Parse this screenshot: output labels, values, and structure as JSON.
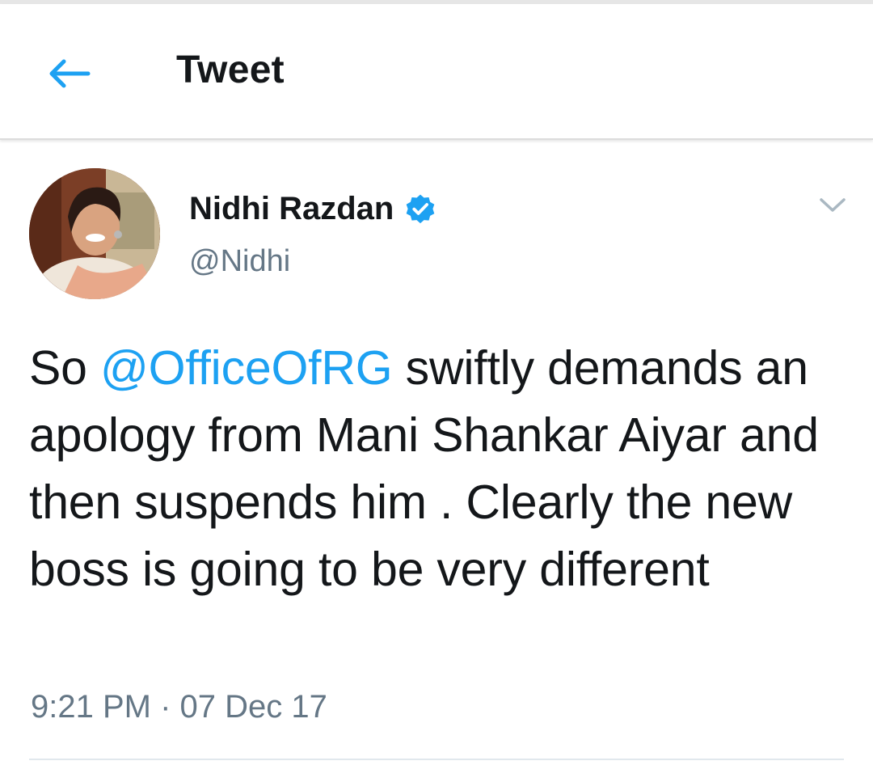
{
  "header": {
    "back_icon": "arrow-left-icon",
    "title": "Tweet"
  },
  "colors": {
    "accent": "#1da1f2",
    "text": "#14171a",
    "secondary_text": "#657786",
    "divider": "#e1e8ed"
  },
  "tweet": {
    "author": {
      "name": "Nidhi Razdan",
      "handle": "@Nidhi",
      "verified": true,
      "verified_icon": "verified-badge-icon",
      "avatar": "profile-photo"
    },
    "menu_icon": "chevron-down-icon",
    "text": {
      "prefix": "So ",
      "mention": "@OfficeOfRG",
      "suffix": " swiftly demands an apology from Mani Shankar Aiyar and then suspends him . Clearly the new boss is going to be very different"
    },
    "time": "9:21 PM",
    "separator": "·",
    "date": "07 Dec 17"
  }
}
